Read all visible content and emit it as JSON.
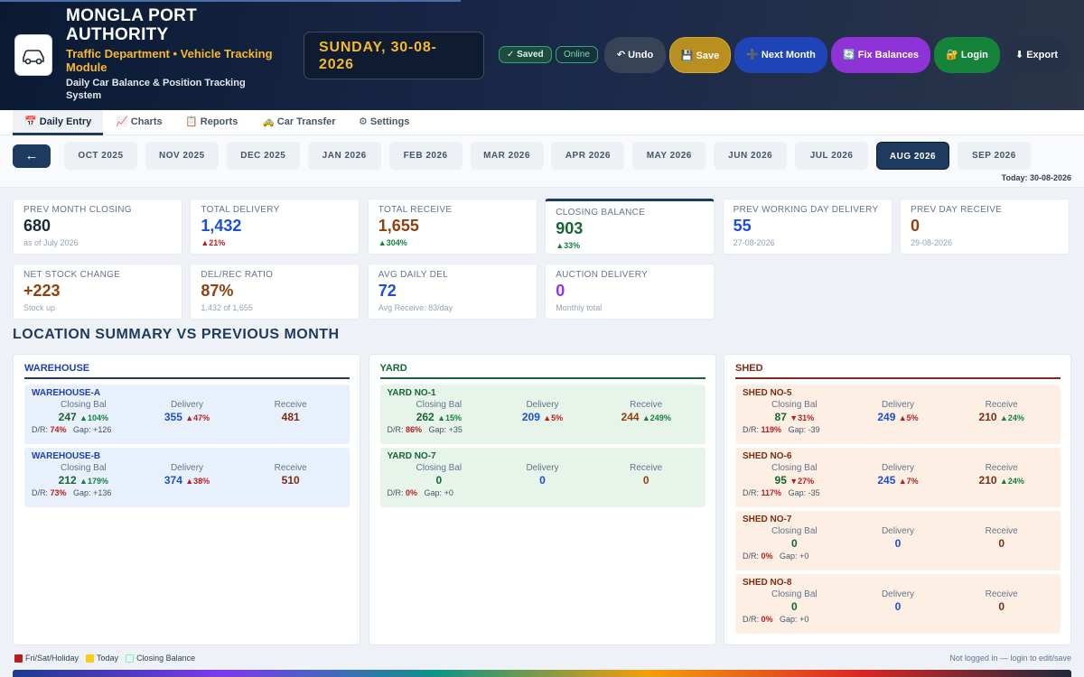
{
  "header": {
    "title": "MONGLA PORT AUTHORITY",
    "subtitle": "Traffic Department • Vehicle Tracking Module",
    "description": "Daily Car Balance & Position Tracking System",
    "date": "SUNDAY, 30-08-2026",
    "status_saved": "✓ Saved",
    "status_online": "Online",
    "buttons": {
      "undo": "↶ Undo",
      "save": "💾 Save",
      "next_month": "➕ Next Month",
      "fix_balances": "🔄 Fix Balances",
      "login": "🔐 Login",
      "export": "⬇ Export"
    }
  },
  "tabs": [
    "📅 Daily Entry",
    "📈 Charts",
    "📋 Reports",
    "🚕 Car Transfer",
    "⚙ Settings"
  ],
  "months": {
    "back": "←",
    "items": [
      "OCT 2025",
      "NOV 2025",
      "DEC 2025",
      "JAN 2026",
      "FEB 2026",
      "MAR 2026",
      "APR 2026",
      "MAY 2026",
      "JUN 2026",
      "JUL 2026",
      "AUG 2026",
      "SEP 2026"
    ],
    "active": "AUG 2026",
    "today": "Today: 30-08-2026"
  },
  "cards": [
    {
      "label": "PREV MONTH CLOSING",
      "value": "680",
      "sub": "as of July 2026",
      "color": "#1e293b"
    },
    {
      "label": "TOTAL DELIVERY",
      "value": "1,432",
      "sub": "▲21%",
      "color": "#1d4ed8"
    },
    {
      "label": "TOTAL RECEIVE",
      "value": "1,655",
      "sub": "▲304%",
      "color": "#92400e"
    },
    {
      "label": "CLOSING BALANCE",
      "value": "903",
      "sub": "▲33%",
      "color": "#166534"
    },
    {
      "label": "PREV WORKING DAY DELIVERY",
      "value": "55",
      "sub": "27-08-2026",
      "color": "#1d4ed8"
    },
    {
      "label": "PREV DAY RECEIVE",
      "value": "0",
      "sub": "29-08-2026",
      "color": "#92400e"
    },
    {
      "label": "NET STOCK CHANGE",
      "value": "+223",
      "sub": "Stock up",
      "color": "#92400e"
    },
    {
      "label": "DEL/REC RATIO",
      "value": "87%",
      "sub": "1,432 of 1,655",
      "color": "#92400e"
    },
    {
      "label": "AVG DAILY DEL",
      "value": "72",
      "sub": "Avg Receive: 83/day",
      "color": "#1d4ed8"
    },
    {
      "label": "AUCTION DELIVERY",
      "value": "0",
      "sub": "Monthly total",
      "color": "#9333ea"
    }
  ],
  "section_title": "LOCATION SUMMARY VS PREVIOUS MONTH",
  "col_labels": {
    "closing": "Closing Bal",
    "delivery": "Delivery",
    "receive": "Receive",
    "dr": "D/R:",
    "gap": "Gap:"
  },
  "groups": [
    {
      "title": "WAREHOUSE",
      "locations": [
        {
          "name": "WAREHOUSE-A",
          "closing": "247",
          "closing_chg": "▲104%",
          "delivery": "355",
          "delivery_chg": "▲47%",
          "receive": "481",
          "receive_chg": "",
          "dr": "74%",
          "gap": "+126"
        },
        {
          "name": "WAREHOUSE-B",
          "closing": "212",
          "closing_chg": "▲179%",
          "delivery": "374",
          "delivery_chg": "▲38%",
          "receive": "510",
          "receive_chg": "",
          "dr": "73%",
          "gap": "+136"
        }
      ]
    },
    {
      "title": "YARD",
      "locations": [
        {
          "name": "YARD NO-1",
          "closing": "262",
          "closing_chg": "▲15%",
          "delivery": "209",
          "delivery_chg": "▲5%",
          "receive": "244",
          "receive_chg": "▲249%",
          "dr": "86%",
          "gap": "+35"
        },
        {
          "name": "YARD NO-7",
          "closing": "0",
          "closing_chg": "",
          "delivery": "0",
          "delivery_chg": "",
          "receive": "0",
          "receive_chg": "",
          "dr": "0%",
          "gap": "+0"
        }
      ]
    },
    {
      "title": "SHED",
      "locations": [
        {
          "name": "SHED NO-5",
          "closing": "87",
          "closing_chg": "▼31%",
          "delivery": "249",
          "delivery_chg": "▲5%",
          "receive": "210",
          "receive_chg": "▲24%",
          "dr": "119%",
          "gap": "-39"
        },
        {
          "name": "SHED NO-6",
          "closing": "95",
          "closing_chg": "▼27%",
          "delivery": "245",
          "delivery_chg": "▲7%",
          "receive": "210",
          "receive_chg": "▲24%",
          "dr": "117%",
          "gap": "-35"
        },
        {
          "name": "SHED NO-7",
          "closing": "0",
          "closing_chg": "",
          "delivery": "0",
          "delivery_chg": "",
          "receive": "0",
          "receive_chg": "",
          "dr": "0%",
          "gap": "+0"
        },
        {
          "name": "SHED NO-8",
          "closing": "0",
          "closing_chg": "",
          "delivery": "0",
          "delivery_chg": "",
          "receive": "0",
          "receive_chg": "",
          "dr": "0%",
          "gap": "+0"
        }
      ]
    }
  ],
  "legend": {
    "holiday": "Fri/Sat/Holiday",
    "today": "Today",
    "closing": "Closing Balance"
  },
  "footer_note": "Not logged in — login to edit/save"
}
